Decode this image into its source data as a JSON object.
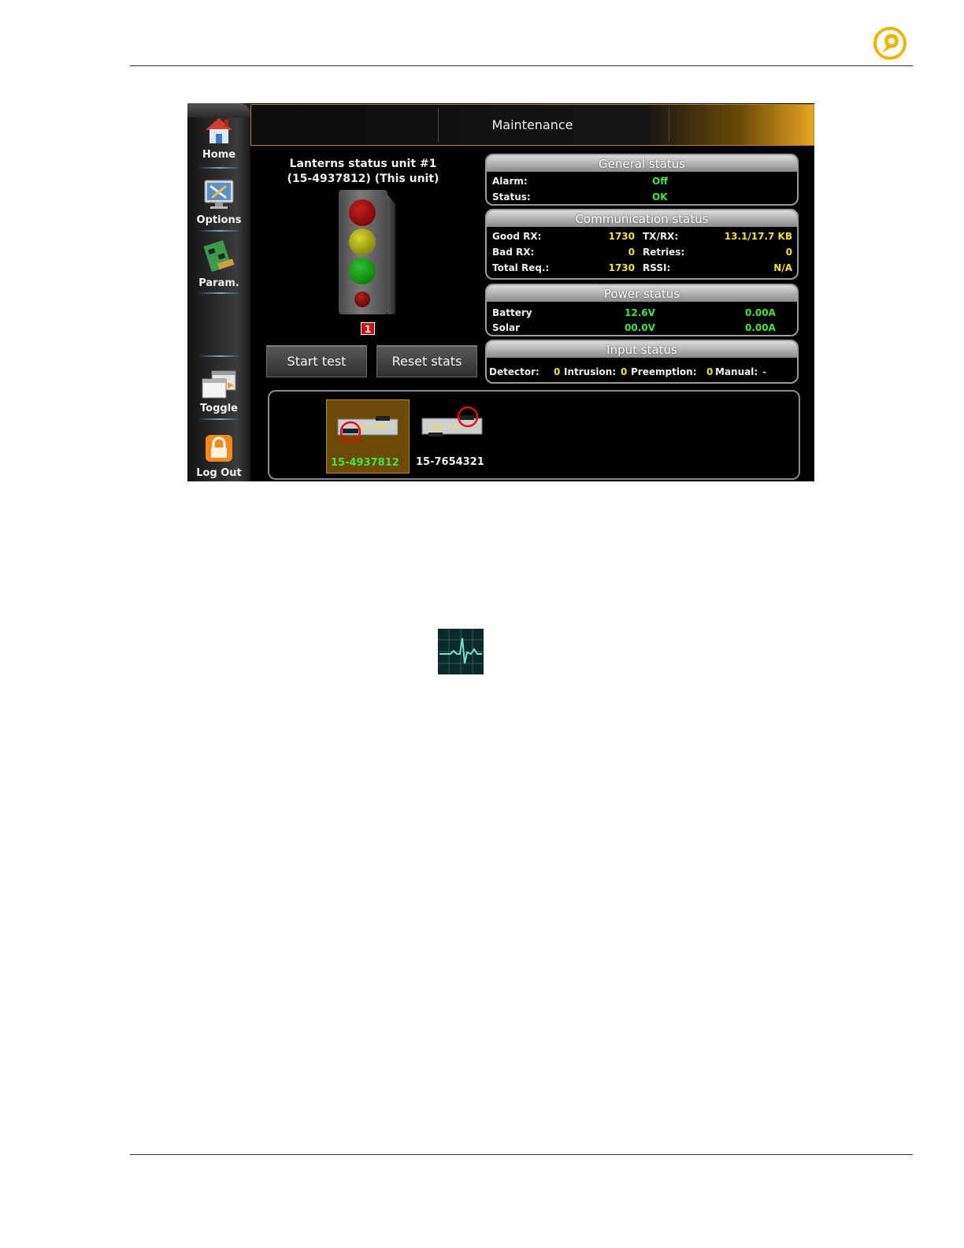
{
  "header": {
    "title": "Maintenance"
  },
  "sidebar": {
    "items": [
      {
        "label": "Home",
        "icon": "home-icon"
      },
      {
        "label": "Options",
        "icon": "options-icon"
      },
      {
        "label": "Param.",
        "icon": "param-icon"
      },
      {
        "label": "Toggle",
        "icon": "toggle-icon"
      },
      {
        "label": "Log Out",
        "icon": "lock-icon"
      }
    ]
  },
  "lanterns": {
    "title_line1": "Lanterns status unit #1",
    "title_line2": "(15-4937812) (This unit)",
    "badge": "1"
  },
  "buttons": {
    "start_test": "Start test",
    "reset_stats": "Reset stats"
  },
  "general_status": {
    "title": "General status",
    "alarm_label": "Alarm:",
    "alarm_value": "Off",
    "status_label": "Status:",
    "status_value": "OK"
  },
  "communication_status": {
    "title": "Communication status",
    "good_rx_label": "Good RX:",
    "good_rx_value": "1730",
    "txrx_label": "TX/RX:",
    "txrx_value": "13.1/17.7 KB",
    "bad_rx_label": "Bad RX:",
    "bad_rx_value": "0",
    "retries_label": "Retries:",
    "retries_value": "0",
    "total_req_label": "Total Req.:",
    "total_req_value": "1730",
    "rssi_label": "RSSI:",
    "rssi_value": "N/A"
  },
  "power_status": {
    "title": "Power status",
    "battery_label": "Battery",
    "battery_voltage": "12.6V",
    "battery_current": "0.00A",
    "solar_label": "Solar",
    "solar_voltage": "00.0V",
    "solar_current": "0.00A"
  },
  "input_status": {
    "title": "Input status",
    "detector_label": "Detector:",
    "detector_value": "0",
    "intrusion_label": "Intrusion:",
    "intrusion_value": "0",
    "preemption_label": "Preemption:",
    "preemption_value": "0",
    "manual_label": "Manual:",
    "manual_value": "-"
  },
  "units": [
    {
      "id": "15-4937812",
      "selected": true
    },
    {
      "id": "15-7654321",
      "selected": false
    }
  ],
  "colors": {
    "accent": "#e8a520",
    "value_green": "#3fe63f",
    "value_yellow": "#f2e030",
    "alert_red": "#d01010"
  }
}
